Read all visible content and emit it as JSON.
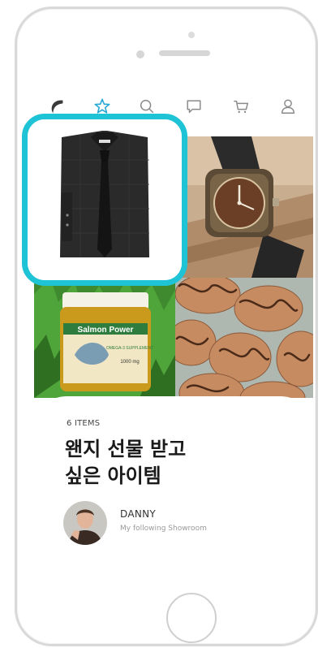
{
  "icons": {
    "logo": "logo-icon",
    "favorites": "star-icon",
    "search": "search-icon",
    "chat": "chat-icon",
    "cart": "cart-icon",
    "profile": "user-icon"
  },
  "colors": {
    "accent": "#1fc3d6",
    "favorite_icon": "#29a9d6"
  },
  "tiles": [
    "shirt-with-tie",
    "wooden-wristwatch",
    "salmon-power-supplement-jar",
    "chocolate-drizzled-cookies"
  ],
  "jar_label": {
    "brand": "Salmon Power",
    "subtitle": "OMEGA-3 SUPPLEMENT",
    "dose": "1000 mg"
  },
  "showroom": {
    "count_label": "6 ITEMS",
    "title": "왠지 선물 받고\n싶은 아이템",
    "user_name": "DANNY",
    "user_subtitle": "My following Showroom"
  }
}
